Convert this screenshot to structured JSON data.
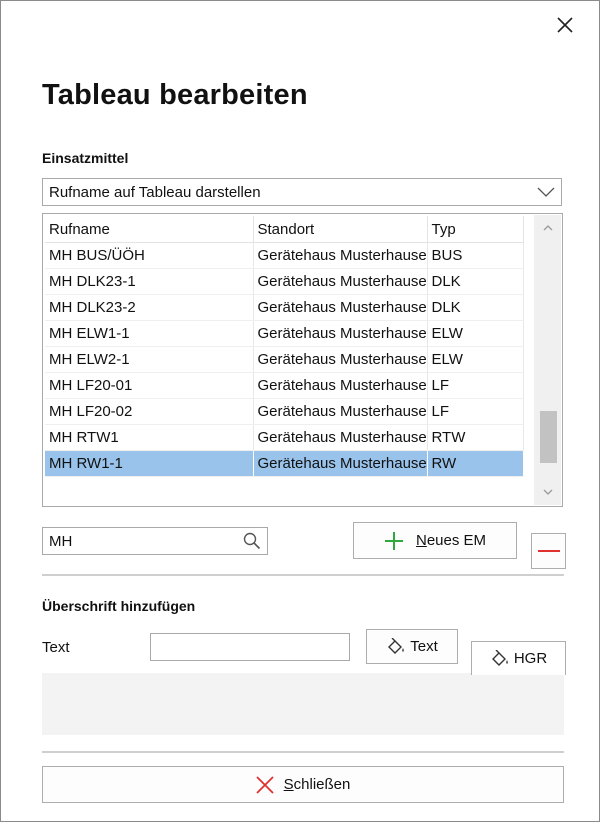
{
  "dialog": {
    "title": "Tableau bearbeiten",
    "close_icon": "close-icon"
  },
  "einsatzmittel": {
    "section_label": "Einsatzmittel",
    "display_mode": {
      "selected": "Rufname auf Tableau darstellen",
      "icon": "chevron-down-icon"
    },
    "table": {
      "columns": [
        "Rufname",
        "Standort",
        "Typ"
      ],
      "rows": [
        {
          "rufname": "MH BUS/ÜÖH",
          "standort": "Gerätehaus Musterhausen",
          "typ": "BUS",
          "selected": false
        },
        {
          "rufname": "MH DLK23-1",
          "standort": "Gerätehaus Musterhausen",
          "typ": "DLK",
          "selected": false
        },
        {
          "rufname": "MH DLK23-2",
          "standort": "Gerätehaus Musterhausen",
          "typ": "DLK",
          "selected": false
        },
        {
          "rufname": "MH ELW1-1",
          "standort": "Gerätehaus Musterhausen",
          "typ": "ELW",
          "selected": false
        },
        {
          "rufname": "MH ELW2-1",
          "standort": "Gerätehaus Musterhausen",
          "typ": "ELW",
          "selected": false
        },
        {
          "rufname": "MH LF20-01",
          "standort": "Gerätehaus Musterhausen",
          "typ": "LF",
          "selected": false
        },
        {
          "rufname": "MH LF20-02",
          "standort": "Gerätehaus Musterhausen",
          "typ": "LF",
          "selected": false
        },
        {
          "rufname": "MH RTW1",
          "standort": "Gerätehaus Musterhausen",
          "typ": "RTW",
          "selected": false
        },
        {
          "rufname": "MH RW1-1",
          "standort": "Gerätehaus Musterhausen",
          "typ": "RW",
          "selected": true
        }
      ]
    },
    "search": {
      "value": "MH",
      "icon": "search-icon"
    },
    "new_button": {
      "accel": "N",
      "rest": "eues EM",
      "icon": "plus-icon"
    },
    "remove_button": {
      "icon": "minus-icon"
    }
  },
  "ueberschrift": {
    "section_label": "Überschrift hinzufügen",
    "text_label": "Text",
    "text_value": "",
    "text_color_button": {
      "label": "Text",
      "icon": "paint-bucket-icon"
    },
    "bg_color_button": {
      "label": "HGR",
      "icon": "paint-bucket-icon"
    }
  },
  "close_button": {
    "accel": "S",
    "rest": "chließen",
    "icon": "close-x-icon"
  },
  "colors": {
    "selection": "#99c3ea",
    "plus": "#2eaa3c",
    "minus": "#e0302f",
    "close_x": "#e0302f"
  }
}
